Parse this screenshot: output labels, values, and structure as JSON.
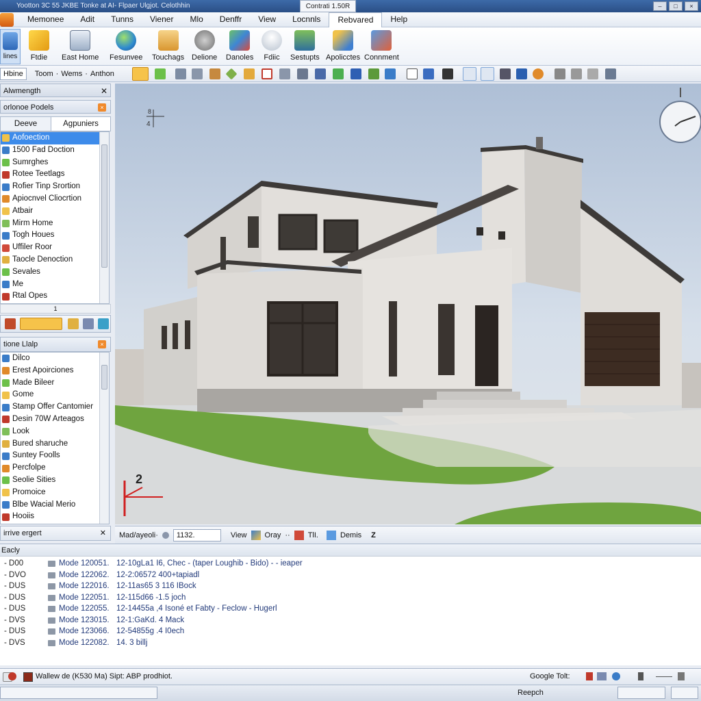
{
  "titlebar": {
    "text": "Yootton 3C 55 JKBE Tonke at AI- Flpaer Ulgjot. Celothhin",
    "center": "Contrati 1.50R"
  },
  "window_buttons": [
    "–",
    "□",
    "×"
  ],
  "menu": [
    "Memonee",
    "Adit",
    "Tunns",
    "Viener",
    "Mlo",
    "Denffr",
    "View",
    "Locnnls",
    "Rebvared",
    "Help"
  ],
  "menu_selected": "Rebvared",
  "ribbon": [
    "Ftdie",
    "East Home",
    "Fesunvee",
    "Touchags",
    "Delione",
    "Danoles",
    "Fdiic",
    "Sestupts",
    "Apolicctes",
    "Connment"
  ],
  "ribbon_left": "lines",
  "toolbar_tabs": [
    "Hbine",
    "Toom",
    "Wems",
    "Anthon"
  ],
  "panel1": {
    "header": "Alwmength",
    "title": "orlonoe Podels",
    "tabs": [
      "Deeve",
      "Agpuniers"
    ],
    "items": [
      "Aofoection",
      "1500 Fad Doction",
      "Sumrghes",
      "Rotee Teetlags",
      "Rofier Tinp Srortion",
      "Apiocnvel Cliocrtion",
      "Atbair",
      "Mirm Home",
      "Togh Houes",
      "Uffiler Roor",
      "Taocle Denoction",
      "Sevales",
      "Me",
      "Rtal Opes"
    ],
    "selected": 0,
    "page_marker": "1"
  },
  "panel2": {
    "title": "tione Llalp",
    "items": [
      "Dilco",
      "Erest Apoirciones",
      "Made Bileer",
      "Gome",
      "Stamp Offer Cantomier",
      "Desin 70W Arteagos",
      "Look",
      "Bured sharuche",
      "Suntey Foolls",
      "Percfolpe",
      "Seolie Sities",
      "Promoice",
      "Blbe Wacial Merio",
      "Hooiis"
    ],
    "footer": "irrive ergert"
  },
  "viewport": {
    "axis_label_top": "8",
    "axis_label_side": "4",
    "corner_label": "2",
    "colors": {
      "wall": "#dcdad6",
      "roof": "#3d3a38",
      "grass": "#6fa43f",
      "garage": "#3d2c22",
      "sky": "#c5d3e4"
    }
  },
  "viewbar": {
    "label": "Mad/ayeoli·",
    "scale": "1132.",
    "view": "View",
    "oray": "Oray",
    "title": "TlI.",
    "dennis": "Demis"
  },
  "log": {
    "header": "Eacly",
    "rows": [
      {
        "c1": "- D00",
        "c2": "Mode 120051.",
        "c3": "12-10gLa1 I6, Chec - (taper Loughib - Bido) - - ieaper"
      },
      {
        "c1": "- DVO",
        "c2": "Mode 122062.",
        "c3": "12-2:06572  400+tapiadl"
      },
      {
        "c1": "- DUS",
        "c2": "Mode 122016.",
        "c3": "12-11as65  3 116 IBock"
      },
      {
        "c1": "- DUS",
        "c2": "Mode 122051.",
        "c3": "12-115d66  -1.5 joch"
      },
      {
        "c1": "- DUS",
        "c2": "Mode 122055.",
        "c3": "12-14455a ,4 Isoné et Fabty - Feclow - Hugerl"
      },
      {
        "c1": "- DVS",
        "c2": "Mode 123015.",
        "c3": "12-1:GaKd. 4 Mack"
      },
      {
        "c1": "- DUS",
        "c2": "Mode 123066.",
        "c3": "12-54855g .4 I0ech"
      },
      {
        "c1": "- DVS",
        "c2": "Mode 122082.",
        "c3": "14. 3 billj"
      }
    ]
  },
  "statusbar": {
    "text": "Wallew de (K530 Ma) Sipt: ABP prodhiot.",
    "right": "Google Tolt:"
  },
  "bottombar": {
    "center": "Reepch"
  }
}
